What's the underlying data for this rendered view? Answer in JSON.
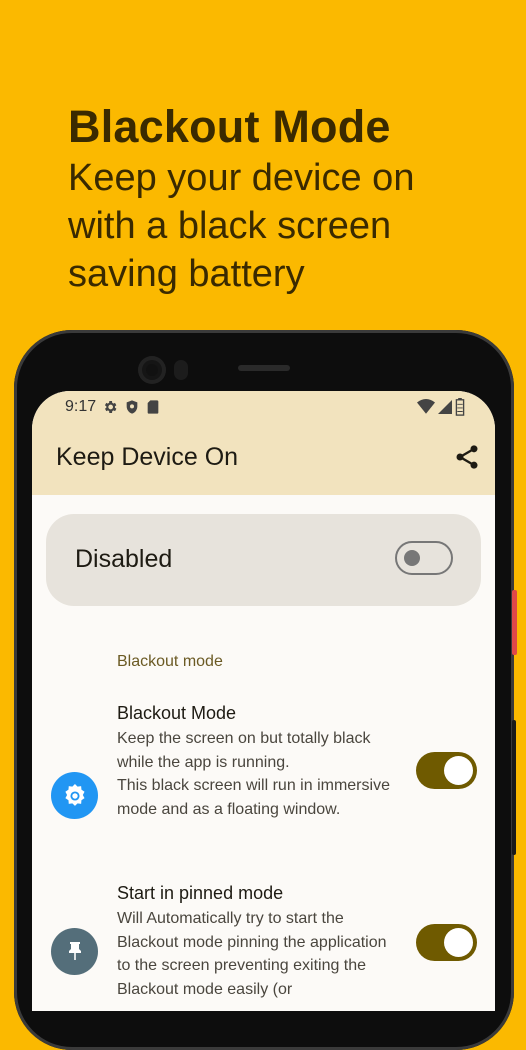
{
  "promo": {
    "title": "Blackout Mode",
    "subtitle": "Keep your device on with a black screen saving battery"
  },
  "status_bar": {
    "time": "9:17",
    "icons": [
      "settings-icon",
      "shield-icon",
      "sd-card-icon",
      "wifi-icon",
      "signal-icon",
      "battery-icon"
    ]
  },
  "app_bar": {
    "title": "Keep Device On",
    "share_icon": "share-icon"
  },
  "main_toggle": {
    "label": "Disabled",
    "state": "off"
  },
  "section": {
    "header": "Blackout mode"
  },
  "preferences": [
    {
      "title": "Blackout Mode",
      "description": "Keep the screen on but totally black while the app is running.\nThis black screen will run in immersive mode and as a floating window.",
      "icon": "gear-icon",
      "icon_color": "#2196f3",
      "enabled": true
    },
    {
      "title": "Start in pinned mode",
      "description": "Will Automatically try to start the Blackout mode pinning the application to the screen preventing exiting the Blackout mode easily (or",
      "icon": "pin-icon",
      "icon_color": "#546e7a",
      "enabled": true
    }
  ],
  "colors": {
    "background": "#fbb900",
    "app_bar": "#f2e3be",
    "switch_on": "#6f5a00"
  }
}
